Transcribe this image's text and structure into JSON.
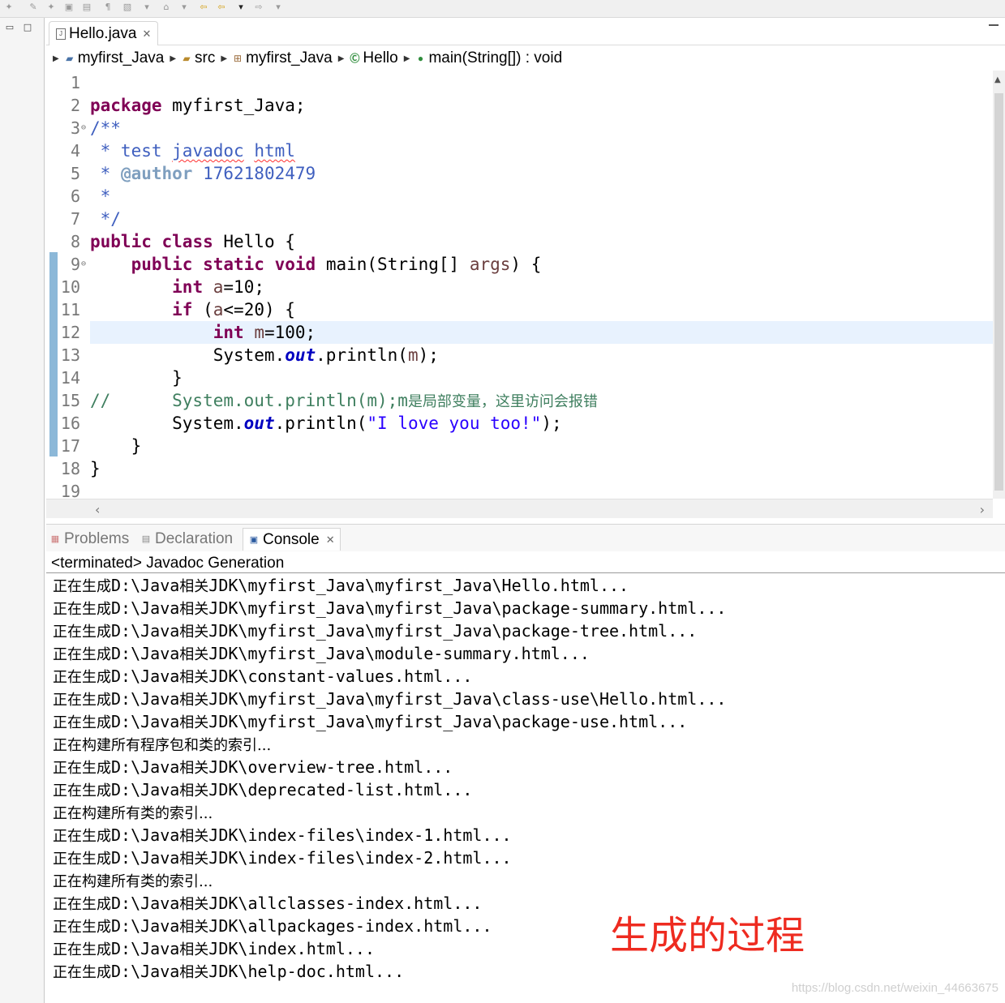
{
  "editor_tab": {
    "label": "Hello.java",
    "close": "✕"
  },
  "breadcrumb": {
    "items": [
      "myfirst_Java",
      "src",
      "myfirst_Java",
      "Hello",
      "main(String[]) : void"
    ]
  },
  "code_lines": [
    {
      "num": "1",
      "tokens": []
    },
    {
      "num": "2",
      "tokens": [
        {
          "t": "package",
          "c": "kw"
        },
        {
          "t": " myfirst_Java;",
          "c": ""
        }
      ]
    },
    {
      "num": "3",
      "fold": true,
      "tokens": [
        {
          "t": "/**",
          "c": "jd"
        }
      ]
    },
    {
      "num": "4",
      "tokens": [
        {
          "t": " * test ",
          "c": "jd"
        },
        {
          "t": "javadoc",
          "c": "jd squig"
        },
        {
          "t": " ",
          "c": "jd"
        },
        {
          "t": "html",
          "c": "jd squig"
        }
      ]
    },
    {
      "num": "5",
      "tokens": [
        {
          "t": " * ",
          "c": "jd"
        },
        {
          "t": "@author",
          "c": "jdtag"
        },
        {
          "t": " 17621802479",
          "c": "jd"
        }
      ]
    },
    {
      "num": "6",
      "tokens": [
        {
          "t": " *",
          "c": "jd"
        }
      ]
    },
    {
      "num": "7",
      "tokens": [
        {
          "t": " */",
          "c": "jd"
        }
      ]
    },
    {
      "num": "8",
      "tokens": [
        {
          "t": "public",
          "c": "kw"
        },
        {
          "t": " ",
          "c": ""
        },
        {
          "t": "class",
          "c": "kw"
        },
        {
          "t": " Hello {",
          "c": ""
        }
      ]
    },
    {
      "num": "9",
      "fold": true,
      "tokens": [
        {
          "t": "    ",
          "c": ""
        },
        {
          "t": "public",
          "c": "kw"
        },
        {
          "t": " ",
          "c": ""
        },
        {
          "t": "static",
          "c": "kw"
        },
        {
          "t": " ",
          "c": ""
        },
        {
          "t": "void",
          "c": "kw"
        },
        {
          "t": " main(String[] ",
          "c": ""
        },
        {
          "t": "args",
          "c": "loc"
        },
        {
          "t": ") {",
          "c": ""
        }
      ]
    },
    {
      "num": "10",
      "tokens": [
        {
          "t": "        ",
          "c": ""
        },
        {
          "t": "int",
          "c": "kw"
        },
        {
          "t": " ",
          "c": ""
        },
        {
          "t": "a",
          "c": "loc"
        },
        {
          "t": "=10;",
          "c": ""
        }
      ]
    },
    {
      "num": "11",
      "tokens": [
        {
          "t": "        ",
          "c": ""
        },
        {
          "t": "if",
          "c": "kw"
        },
        {
          "t": " (",
          "c": ""
        },
        {
          "t": "a",
          "c": "loc"
        },
        {
          "t": "<=20) {",
          "c": ""
        }
      ]
    },
    {
      "num": "12",
      "current": true,
      "tokens": [
        {
          "t": "            ",
          "c": ""
        },
        {
          "t": "int",
          "c": "kw"
        },
        {
          "t": " ",
          "c": ""
        },
        {
          "t": "m",
          "c": "loc"
        },
        {
          "t": "=100;",
          "c": ""
        }
      ]
    },
    {
      "num": "13",
      "tokens": [
        {
          "t": "            System.",
          "c": ""
        },
        {
          "t": "out",
          "c": "fld"
        },
        {
          "t": ".println(",
          "c": ""
        },
        {
          "t": "m",
          "c": "loc"
        },
        {
          "t": ");",
          "c": ""
        }
      ]
    },
    {
      "num": "14",
      "tokens": [
        {
          "t": "        }",
          "c": ""
        }
      ]
    },
    {
      "num": "15",
      "tokens": [
        {
          "t": "//      System.out.println(m);m",
          "c": "cm"
        },
        {
          "t": "是局部变量，这里访问会报错",
          "c": "cmcjk"
        }
      ]
    },
    {
      "num": "16",
      "tokens": [
        {
          "t": "        System.",
          "c": ""
        },
        {
          "t": "out",
          "c": "fld"
        },
        {
          "t": ".println(",
          "c": ""
        },
        {
          "t": "\"I love you too!\"",
          "c": "str"
        },
        {
          "t": ");",
          "c": ""
        }
      ]
    },
    {
      "num": "17",
      "tokens": [
        {
          "t": "    }",
          "c": ""
        }
      ]
    },
    {
      "num": "18",
      "tokens": [
        {
          "t": "}",
          "c": ""
        }
      ]
    },
    {
      "num": "19",
      "tokens": []
    }
  ],
  "views": {
    "tabs": [
      {
        "label": "Problems",
        "active": false
      },
      {
        "label": "Declaration",
        "active": false
      },
      {
        "label": "Console",
        "active": true,
        "close": "✕"
      }
    ]
  },
  "console": {
    "status": "<terminated> Javadoc Generation",
    "lines": [
      [
        "正在生成",
        "D:\\Java",
        "相关",
        "JDK\\myfirst_Java\\myfirst_Java\\Hello.html..."
      ],
      [
        "正在生成",
        "D:\\Java",
        "相关",
        "JDK\\myfirst_Java\\myfirst_Java\\package-summary.html..."
      ],
      [
        "正在生成",
        "D:\\Java",
        "相关",
        "JDK\\myfirst_Java\\myfirst_Java\\package-tree.html..."
      ],
      [
        "正在生成",
        "D:\\Java",
        "相关",
        "JDK\\myfirst_Java\\module-summary.html..."
      ],
      [
        "正在生成",
        "D:\\Java",
        "相关",
        "JDK\\constant-values.html..."
      ],
      [
        "正在生成",
        "D:\\Java",
        "相关",
        "JDK\\myfirst_Java\\myfirst_Java\\class-use\\Hello.html..."
      ],
      [
        "正在生成",
        "D:\\Java",
        "相关",
        "JDK\\myfirst_Java\\myfirst_Java\\package-use.html..."
      ],
      [
        "正在构建所有程序包和类的索引...",
        "",
        "",
        ""
      ],
      [
        "正在生成",
        "D:\\Java",
        "相关",
        "JDK\\overview-tree.html..."
      ],
      [
        "正在生成",
        "D:\\Java",
        "相关",
        "JDK\\deprecated-list.html..."
      ],
      [
        "正在构建所有类的索引...",
        "",
        "",
        ""
      ],
      [
        "正在生成",
        "D:\\Java",
        "相关",
        "JDK\\index-files\\index-1.html..."
      ],
      [
        "正在生成",
        "D:\\Java",
        "相关",
        "JDK\\index-files\\index-2.html..."
      ],
      [
        "正在构建所有类的索引...",
        "",
        "",
        ""
      ],
      [
        "正在生成",
        "D:\\Java",
        "相关",
        "JDK\\allclasses-index.html..."
      ],
      [
        "正在生成",
        "D:\\Java",
        "相关",
        "JDK\\allpackages-index.html..."
      ],
      [
        "正在生成",
        "D:\\Java",
        "相关",
        "JDK\\index.html..."
      ],
      [
        "正在生成",
        "D:\\Java",
        "相关",
        "JDK\\help-doc.html..."
      ]
    ]
  },
  "annotation": "生成的过程",
  "watermark": "https://blog.csdn.net/weixin_44663675",
  "colors": {
    "keyword": "#7f0055",
    "javadoc": "#3f5fbf",
    "comment": "#3f7f5f",
    "string": "#2a00ff",
    "field": "#0000c0",
    "annotation": "#ee2b20",
    "current_line": "#e8f2fe"
  }
}
